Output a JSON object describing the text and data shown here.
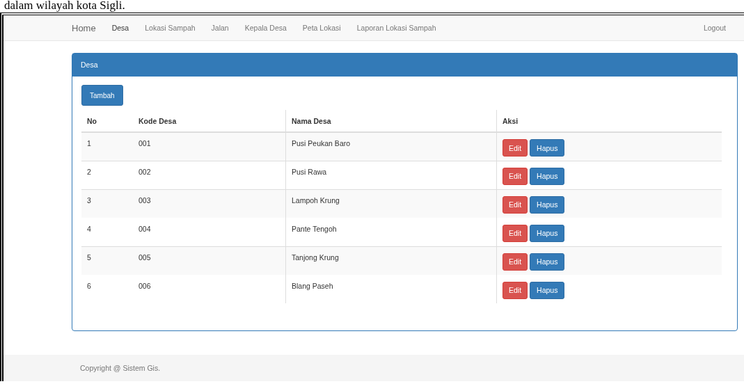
{
  "caption": "dalam wilayah kota Sigli.",
  "navbar": {
    "brand": "Home",
    "items": [
      {
        "label": "Desa",
        "selected": true
      },
      {
        "label": "Lokasi Sampah",
        "selected": false
      },
      {
        "label": "Jalan",
        "selected": false
      },
      {
        "label": "Kepala Desa",
        "selected": false
      },
      {
        "label": "Peta Lokasi",
        "selected": false
      },
      {
        "label": "Laporan Lokasi Sampah",
        "selected": false
      }
    ],
    "logout": "Logout"
  },
  "panel": {
    "title": "Desa",
    "add_button": "Tambah",
    "table": {
      "columns": [
        "No",
        "Kode Desa",
        "Nama Desa",
        "Aksi"
      ],
      "rows": [
        {
          "no": "1",
          "kode": "001",
          "nama": "Pusi Peukan Baro",
          "actions": [
            "Edit",
            "Hapus"
          ]
        },
        {
          "no": "2",
          "kode": "002",
          "nama": "Pusi Rawa",
          "actions": [
            "Edit",
            "Hapus"
          ]
        },
        {
          "no": "3",
          "kode": "003",
          "nama": "Lampoh Krung",
          "actions": [
            "Edit",
            "Hapus"
          ]
        },
        {
          "no": "4",
          "kode": "004",
          "nama": "Pante Tengoh",
          "actions": [
            "Edit",
            "Hapus"
          ]
        },
        {
          "no": "5",
          "kode": "005",
          "nama": "Tanjong Krung",
          "actions": [
            "Edit",
            "Hapus"
          ]
        },
        {
          "no": "6",
          "kode": "006",
          "nama": "Blang Paseh",
          "actions": [
            "Edit",
            "Hapus"
          ]
        }
      ]
    }
  },
  "footer": "Copyright @ Sistem Gis."
}
